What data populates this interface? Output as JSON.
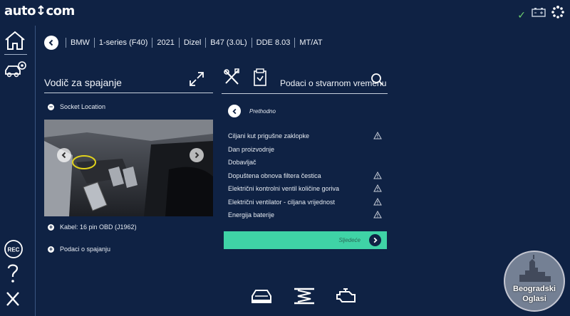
{
  "app": {
    "logo": "auto↕com"
  },
  "vehicle_bar": {
    "items": [
      "BMW",
      "1-series (F40)",
      "2021",
      "Dizel",
      "B47 (3.0L)",
      "DDE 8.03",
      "MT/AT"
    ]
  },
  "left_panel": {
    "title": "Vodič za spajanje",
    "socket_location": "Socket Location",
    "kabel": "Kabel: 16 pin OBD (J1962)",
    "podaci": "Podaci o spajanju"
  },
  "right_panel": {
    "title": "Podaci o stvarnom vremenu",
    "previous_label": "Prethodno",
    "next_label": "Sljedeće",
    "params": [
      {
        "label": "Ciljani kut prigušne zaklopke",
        "warn": true
      },
      {
        "label": "Dan proizvodnje",
        "warn": false
      },
      {
        "label": "Dobavljač",
        "warn": false
      },
      {
        "label": "Dopuštena obnova filtera čestica",
        "warn": true
      },
      {
        "label": "Električni kontrolni ventil količine goriva",
        "warn": true
      },
      {
        "label": "Električni ventilator - ciljana vrijednost",
        "warn": true
      },
      {
        "label": "Energija baterije",
        "warn": true
      }
    ]
  },
  "sidebar": {
    "rec_label": "REC"
  },
  "watermark": {
    "line1": "Beogradski",
    "line2": "Oglasi"
  },
  "colors": {
    "background": "#0f2244",
    "accent": "#3fd3a6",
    "warning": "#c9cfd9"
  }
}
